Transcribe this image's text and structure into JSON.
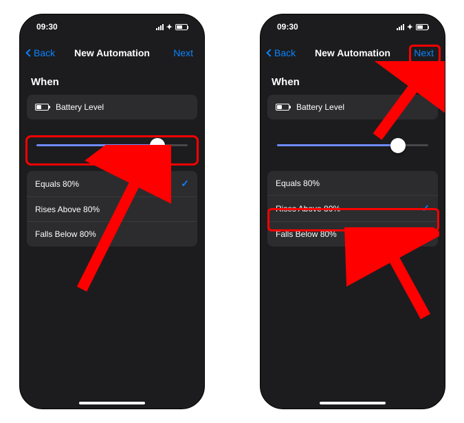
{
  "status": {
    "time": "09:30"
  },
  "nav": {
    "back": "Back",
    "title": "New Automation",
    "next": "Next"
  },
  "section_when": "When",
  "trigger": {
    "label": "Battery Level"
  },
  "slider": {
    "value_pct": 80
  },
  "options": {
    "equals": "Equals 80%",
    "rises": "Rises Above 80%",
    "falls": "Falls Below 80%"
  },
  "left": {
    "selected": "equals"
  },
  "right": {
    "selected": "rises"
  }
}
